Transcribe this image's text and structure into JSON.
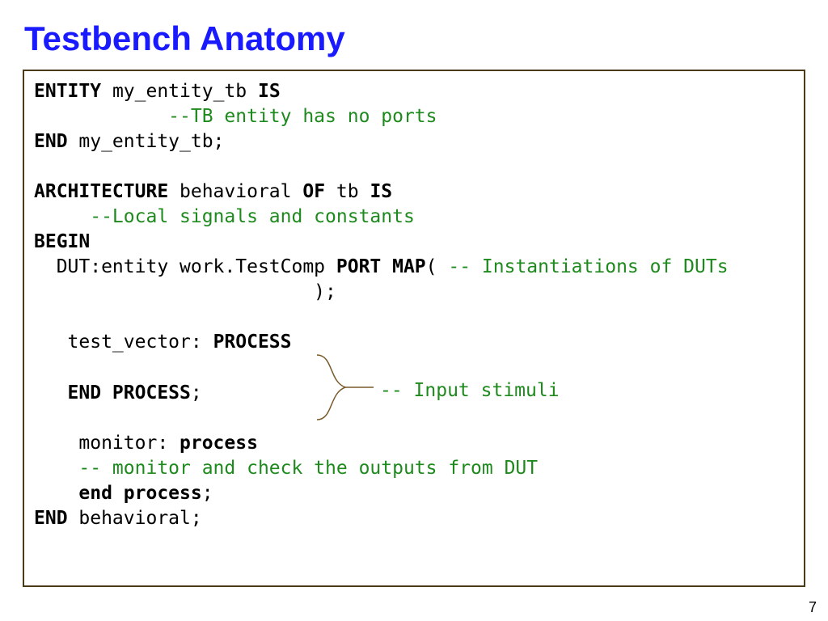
{
  "slide": {
    "title": "Testbench Anatomy",
    "page_number": "7"
  },
  "code": {
    "l1_kw1": "ENTITY",
    "l1_txt1": " my_entity_tb ",
    "l1_kw2": "IS",
    "l2_cmt": "            --TB entity has no ports",
    "l3_kw1": "END",
    "l3_txt1": " my_entity_tb;",
    "blank1": " ",
    "l5_kw1": "ARCHITECTURE",
    "l5_txt1": " behavioral ",
    "l5_kw2": "OF",
    "l5_txt2": " tb ",
    "l5_kw3": "IS",
    "l6_cmt": "     --Local signals and constants",
    "l7_kw1": "BEGIN",
    "l8_txt1": "  DUT:entity work.TestComp ",
    "l8_kw1": "PORT MAP",
    "l8_txt2": "( ",
    "l8_cmt": "-- Instantiations of DUTs",
    "l9_txt1": "                         );",
    "blank2": " ",
    "l11_txt1": "   test_vector: ",
    "l11_kw1": "PROCESS",
    "blank3": " ",
    "l13_txt1": "   ",
    "l13_kw1": "END PROCESS",
    "l13_txt2": ";",
    "blank4": " ",
    "l15_txt1": "    monitor: ",
    "l15_kw1": "process",
    "l16_txt1": "    ",
    "l16_cmt": "-- monitor and check the outputs from DUT",
    "l17_txt1": "    ",
    "l17_kw1": "end process",
    "l17_txt2": ";",
    "l18_kw1": "END",
    "l18_txt1": " behavioral;",
    "stimuli_cmt": "-- Input stimuli"
  }
}
